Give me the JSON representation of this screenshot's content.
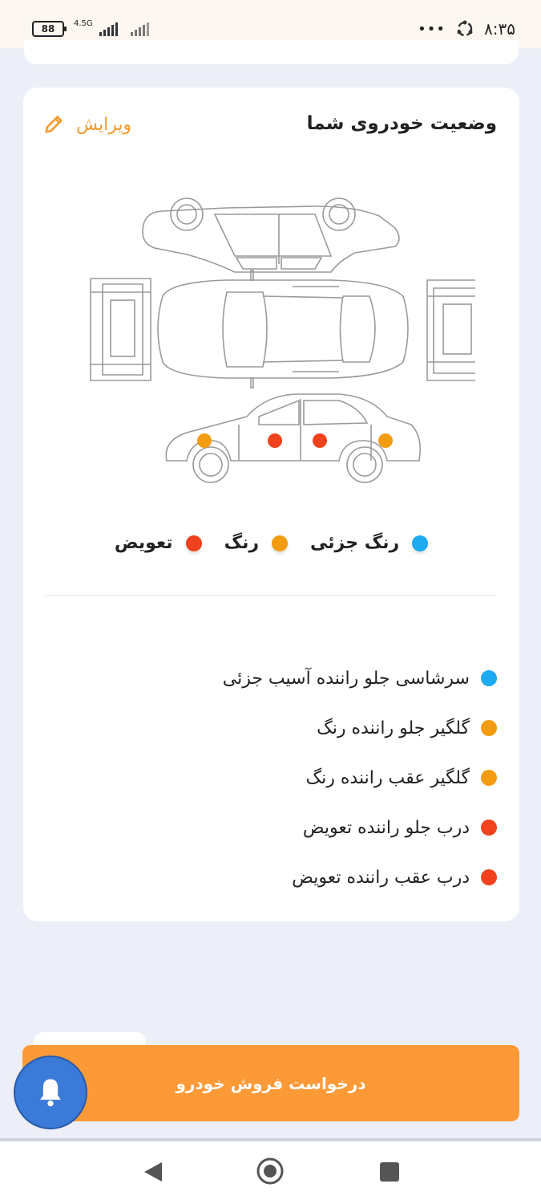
{
  "status_bar": {
    "battery": "88",
    "network": "4.5G",
    "time": "۸:۳۵",
    "dots": "•••"
  },
  "card": {
    "title": "وضعیت خودروی شما",
    "edit_label": "ویرایش"
  },
  "legend": [
    {
      "label": "رنگ جزئی",
      "color": "#1eaaf1"
    },
    {
      "label": "رنگ",
      "color": "#f39c12"
    },
    {
      "label": "تعویض",
      "color": "#f0421c"
    }
  ],
  "issues": [
    {
      "text": "سرشاسی جلو راننده آسیب جزئی",
      "color": "#1eaaf1"
    },
    {
      "text": "گلگیر جلو راننده رنگ",
      "color": "#f39c12"
    },
    {
      "text": "گلگیر عقب راننده رنگ",
      "color": "#f39c12"
    },
    {
      "text": "درب جلو راننده تعویض",
      "color": "#f0421c"
    },
    {
      "text": "درب عقب راننده تعویض",
      "color": "#f0421c"
    }
  ],
  "sell_button": {
    "label": "درخواست فروش خودرو",
    "color": "#fd9a38"
  },
  "icons": {
    "edit": "pencil-icon",
    "notification": "bell-icon",
    "nav_back": "back-triangle-icon",
    "nav_home": "home-circle-icon",
    "nav_recent": "recent-square-icon"
  }
}
